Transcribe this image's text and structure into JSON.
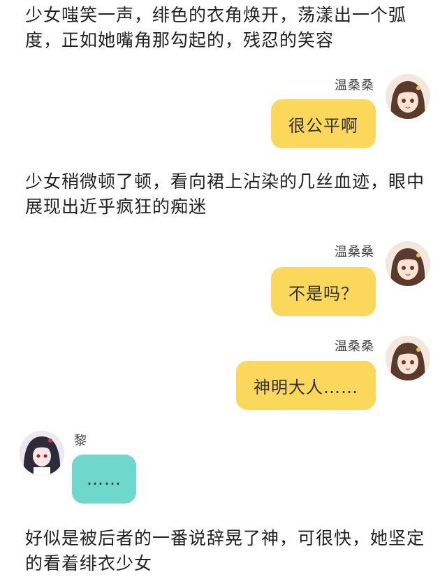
{
  "narration": [
    "少女嗤笑一声，绯色的衣角焕开，荡漾出一个弧度，正如她嘴角那勾起的，残忍的笑容",
    "少女稍微顿了顿，看向裙上沾染的几丝血迹，眼中展现出近乎疯狂的痴迷",
    "好似是被后者的一番说辞晃了神，可很快，她坚定的看着绯衣少女"
  ],
  "messages": [
    {
      "sender": "温桑桑",
      "text": "很公平啊",
      "avatar": "girl-avatar-icon",
      "color": "#fbd75c"
    },
    {
      "sender": "温桑桑",
      "text": "不是吗？",
      "avatar": "girl-avatar-icon",
      "color": "#fbd75c"
    },
    {
      "sender": "温桑桑",
      "text": "神明大人……",
      "avatar": "girl-avatar-icon",
      "color": "#fbd75c"
    },
    {
      "sender": "黎",
      "text": "……",
      "avatar": "dark-hair-avatar-icon",
      "color": "#6fd7cb"
    }
  ]
}
